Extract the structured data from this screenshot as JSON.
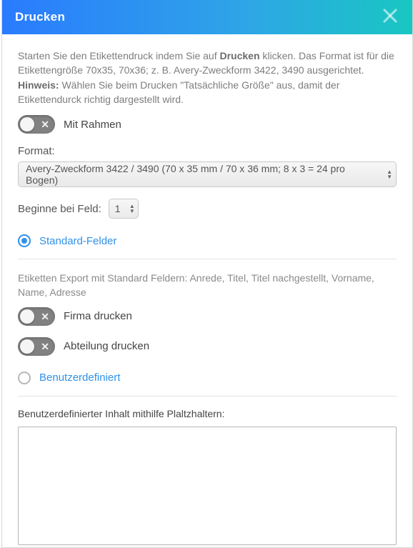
{
  "header": {
    "title": "Drucken"
  },
  "intro": {
    "line1_pre": "Starten Sie den Etikettendruck indem Sie auf ",
    "line1_strong": "Drucken",
    "line1_post": " klicken. Das Format ist für die Etikettengröße 70x35, 70x36; z. B. Avery-Zweckform 3422, 3490 ausgerichtet.",
    "hint_strong": "Hinweis:",
    "hint_post": " Wählen Sie beim Drucken \"Tatsächliche Größe\" aus, damit der Etikettendurck richtig dargestellt wird."
  },
  "toggles": {
    "frame": "Mit Rahmen",
    "company": "Firma drucken",
    "department": "Abteilung drucken"
  },
  "format": {
    "label": "Format:",
    "value": "Avery-Zweckform 3422 / 3490 (70 x 35 mm / 70 x 36 mm; 8 x 3 = 24 pro Bogen)"
  },
  "start_field": {
    "label": "Beginne bei Feld:",
    "value": "1"
  },
  "radios": {
    "standard": "Standard-Felder",
    "custom": "Benutzerdefiniert"
  },
  "standard_hint": "Etiketten Export mit Standard Feldern: Anrede, Titel, Titel nachgestellt, Vorname, Name, Adresse",
  "custom_section": {
    "label": "Benutzerdefinierter Inhalt mithilfe Plaltzhaltern:"
  }
}
